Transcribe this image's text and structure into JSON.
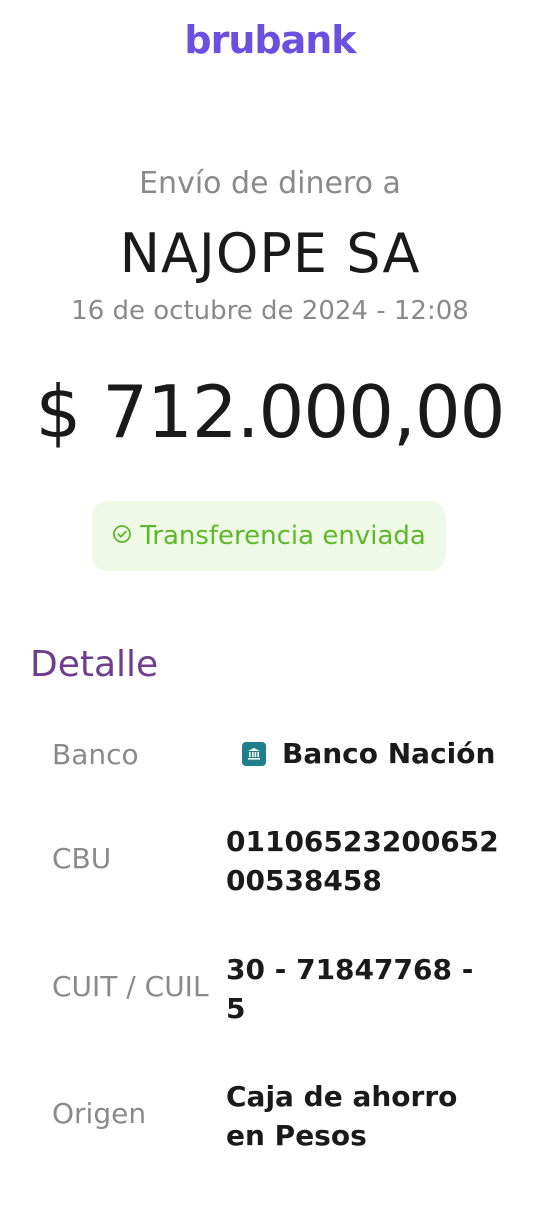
{
  "brand": {
    "logo_text": "brubank",
    "brand_color": "#6B4FE0"
  },
  "transfer": {
    "subtitle": "Envío de dinero a",
    "recipient": "NAJOPE SA",
    "datetime": "16 de octubre de 2024 - 12:08",
    "amount": "$ 712.000,00",
    "status": {
      "label": "Transferencia enviada",
      "icon": "check-circle-icon",
      "text_color": "#5FB82C",
      "background": "#EEFAE6"
    }
  },
  "detail": {
    "title": "Detalle",
    "title_color": "#6E3D8E",
    "rows": {
      "banco": {
        "label": "Banco",
        "value": "Banco Nación",
        "icon": "bank-icon"
      },
      "cbu": {
        "label": "CBU",
        "value": "0110652320065200538458"
      },
      "cuit": {
        "label": "CUIT / CUIL",
        "value_line1": "30 - 71847768 -",
        "value_line2": "5"
      },
      "origen": {
        "label": "Origen",
        "value_line1": "Caja de ahorro",
        "value_line2": "en Pesos"
      }
    }
  }
}
